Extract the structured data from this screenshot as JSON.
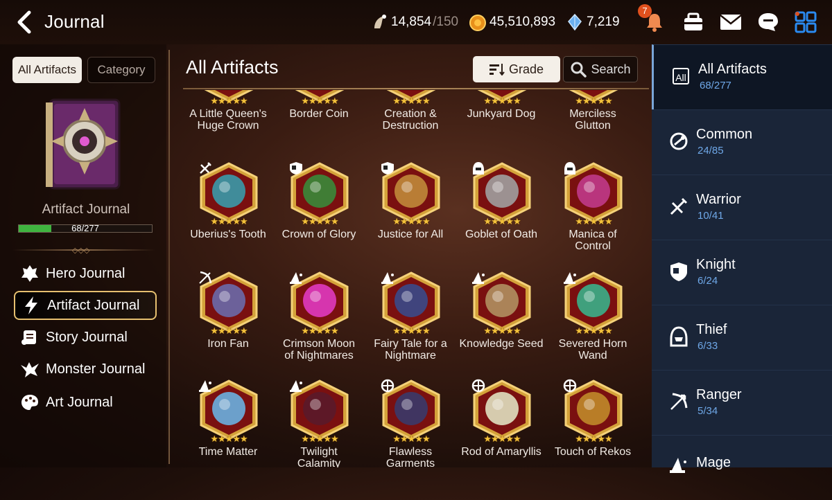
{
  "header": {
    "title": "Journal",
    "stamina": "14,854",
    "stamina_max": "/150",
    "gold": "45,510,893",
    "crystals": "7,219",
    "notification_count": "7"
  },
  "left": {
    "tabs": [
      "All Artifacts",
      "Category"
    ],
    "journal_label": "Artifact Journal",
    "progress_text": "68/277",
    "progress_fraction": 0.245,
    "nav": [
      {
        "label": "Hero Journal",
        "icon": "hero-icon"
      },
      {
        "label": "Artifact Journal",
        "icon": "lightning-icon"
      },
      {
        "label": "Story Journal",
        "icon": "scroll-icon"
      },
      {
        "label": "Monster Journal",
        "icon": "monster-icon"
      },
      {
        "label": "Art Journal",
        "icon": "palette-icon"
      }
    ]
  },
  "main": {
    "title": "All Artifacts",
    "grade_label": "Grade",
    "search_label": "Search",
    "stars": "★★★★★",
    "artifacts": [
      {
        "name": "A Little Queen's Huge Crown",
        "lines": [
          "A Little Queen's",
          "Huge Crown"
        ],
        "color": "#c23a2a",
        "class": "none"
      },
      {
        "name": "Border Coin",
        "lines": [
          "Border Coin",
          ""
        ],
        "color": "#b07a2a",
        "class": "none"
      },
      {
        "name": "Creation & Destruction",
        "lines": [
          "Creation &",
          "Destruction"
        ],
        "color": "#8a2a4a",
        "class": "none"
      },
      {
        "name": "Junkyard Dog",
        "lines": [
          "Junkyard Dog",
          ""
        ],
        "color": "#c2402a",
        "class": "none"
      },
      {
        "name": "Merciless Glutton",
        "lines": [
          "Merciless",
          "Glutton"
        ],
        "color": "#3a6a8a",
        "class": "none"
      },
      {
        "name": "Uberius's Tooth",
        "lines": [
          "Uberius's Tooth",
          ""
        ],
        "color": "#3a9aaa",
        "class": "warrior"
      },
      {
        "name": "Crown of Glory",
        "lines": [
          "Crown of Glory",
          ""
        ],
        "color": "#3a8a3a",
        "class": "knight"
      },
      {
        "name": "Justice for All",
        "lines": [
          "Justice for All",
          ""
        ],
        "color": "#c08a3a",
        "class": "knight"
      },
      {
        "name": "Goblet of Oath",
        "lines": [
          "Goblet of Oath",
          ""
        ],
        "color": "#a0a0a0",
        "class": "thief"
      },
      {
        "name": "Manica of Control",
        "lines": [
          "Manica of",
          "Control"
        ],
        "color": "#c03a8a",
        "class": "thief"
      },
      {
        "name": "Iron Fan",
        "lines": [
          "Iron Fan",
          ""
        ],
        "color": "#6a6aaa",
        "class": "ranger"
      },
      {
        "name": "Crimson Moon of Nightmares",
        "lines": [
          "Crimson Moon",
          "of Nightmares"
        ],
        "color": "#e03ac0",
        "class": "mage"
      },
      {
        "name": "Fairy Tale for a Nightmare",
        "lines": [
          "Fairy Tale for a",
          "Nightmare"
        ],
        "color": "#3a4a8a",
        "class": "mage"
      },
      {
        "name": "Knowledge Seed",
        "lines": [
          "Knowledge Seed",
          ""
        ],
        "color": "#b09060",
        "class": "mage"
      },
      {
        "name": "Severed Horn Wand",
        "lines": [
          "Severed Horn",
          "Wand"
        ],
        "color": "#3ab08a",
        "class": "mage"
      },
      {
        "name": "Time Matter",
        "lines": [
          "Time Matter",
          ""
        ],
        "color": "#6ab0e0",
        "class": "mage"
      },
      {
        "name": "Twilight Calamity",
        "lines": [
          "Twilight",
          "Calamity"
        ],
        "color": "#5a1a2a",
        "class": "mage"
      },
      {
        "name": "Flawless Garments",
        "lines": [
          "Flawless",
          "Garments"
        ],
        "color": "#3a3a6a",
        "class": "soul-weaver"
      },
      {
        "name": "Rod of Amaryllis",
        "lines": [
          "Rod of Amaryllis",
          ""
        ],
        "color": "#e0e0c0",
        "class": "soul-weaver"
      },
      {
        "name": "Touch of Rekos",
        "lines": [
          "Touch of Rekos",
          ""
        ],
        "color": "#c08a2a",
        "class": "soul-weaver"
      }
    ]
  },
  "right": {
    "categories": [
      {
        "label": "All Artifacts",
        "count": "68/277",
        "icon": "all-icon",
        "badge": "All"
      },
      {
        "label": "Common",
        "count": "24/85",
        "icon": "common-icon"
      },
      {
        "label": "Warrior",
        "count": "10/41",
        "icon": "warrior-icon"
      },
      {
        "label": "Knight",
        "count": "6/24",
        "icon": "knight-icon"
      },
      {
        "label": "Thief",
        "count": "6/33",
        "icon": "thief-icon"
      },
      {
        "label": "Ranger",
        "count": "5/34",
        "icon": "ranger-icon"
      },
      {
        "label": "Mage",
        "count": "",
        "icon": "mage-icon"
      }
    ]
  }
}
